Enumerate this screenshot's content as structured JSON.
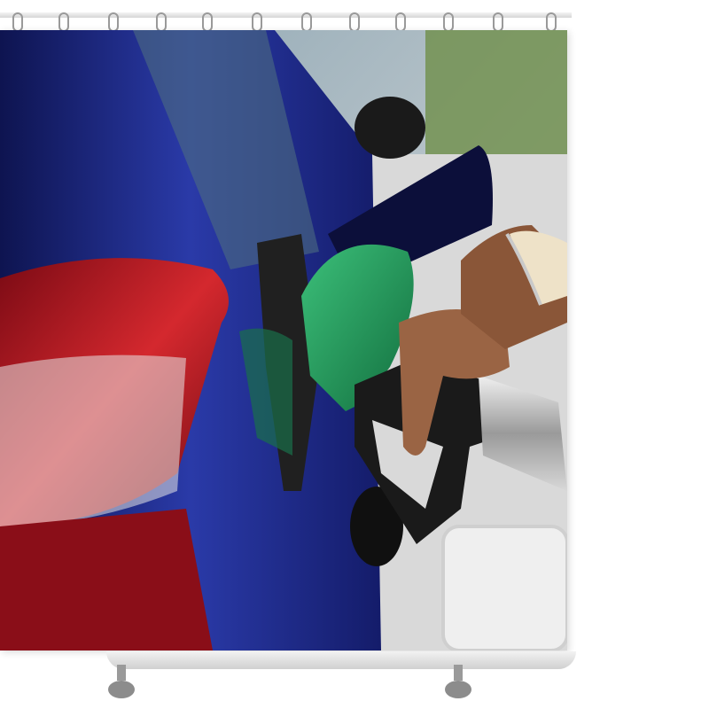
{
  "scene": {
    "subject": "fuel-nozzle-shower-curtain",
    "colors": {
      "car_body": "#1f2a8c",
      "tail_light": "#b8141e",
      "nozzle_green": "#1f9a5a",
      "nozzle_black": "#1a1a1a",
      "hose_metal": "#c8c8c8",
      "skin": "#9a6444",
      "sleeve": "#eee2c8",
      "background_road": "#d9d9d9",
      "foliage": "#6f8f4a"
    }
  }
}
